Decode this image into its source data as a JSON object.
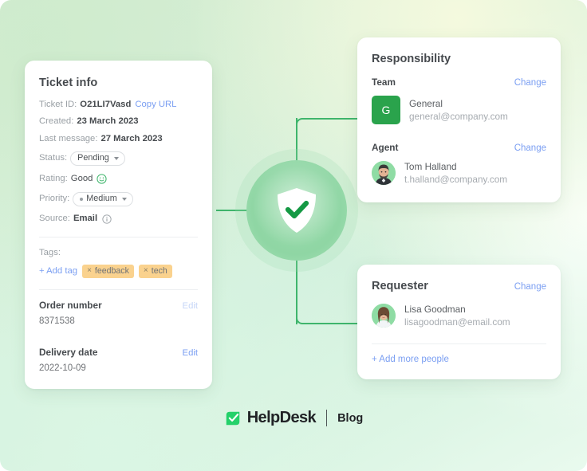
{
  "colors": {
    "accent_green": "#3fb56c",
    "team_badge_green": "#2aa34c",
    "link_blue": "#7b9ff2",
    "tag_orange": "#fad28e",
    "text_dark": "#464a4e",
    "text_muted": "#9aa0a5",
    "shield_circle": "#8fd6a4"
  },
  "ticket_card": {
    "title": "Ticket info",
    "rows": [
      {
        "label": "Ticket ID:",
        "value": "O21LI7Vasd",
        "link": "Copy URL"
      },
      {
        "label": "Created:",
        "value": "23 March 2023"
      },
      {
        "label": "Last message:",
        "value": "27 March 2023"
      }
    ],
    "status": {
      "label": "Status:",
      "value": "Pending"
    },
    "rating": {
      "label": "Rating:",
      "value": "Good",
      "icon": "smiley-happy-icon"
    },
    "priority": {
      "label": "Priority:",
      "value": "Medium"
    },
    "source": {
      "label": "Source:",
      "value": "Email",
      "icon": "info-circle-icon"
    },
    "tags": {
      "label": "Tags:",
      "add_label": "+ Add tag",
      "items": [
        "feedback",
        "tech"
      ],
      "remove_glyph": "×"
    },
    "order_number": {
      "title": "Order number",
      "edit_label": "Edit",
      "value": "8371538"
    },
    "delivery_date": {
      "title": "Delivery date",
      "edit_label": "Edit",
      "value": "2022-10-09"
    }
  },
  "responsibility_card": {
    "title": "Responsibility",
    "team": {
      "section_label": "Team",
      "change_label": "Change",
      "badge_initial": "G",
      "name": "General",
      "email": "general@company.com"
    },
    "agent": {
      "section_label": "Agent",
      "change_label": "Change",
      "name": "Tom Halland",
      "email": "t.halland@company.com",
      "avatar": "agent-avatar-photo"
    }
  },
  "requester_card": {
    "section_label": "Requester",
    "change_label": "Change",
    "name": "Lisa Goodman",
    "email": "lisagoodman@email.com",
    "avatar": "requester-avatar-photo",
    "add_people_label": "+ Add more people"
  },
  "center_badge": {
    "icon": "shield-check-icon"
  },
  "footer": {
    "logo_text": "HelpDesk",
    "logo_icon": "helpdesk-checkbox-logo",
    "blog_label": "Blog"
  }
}
